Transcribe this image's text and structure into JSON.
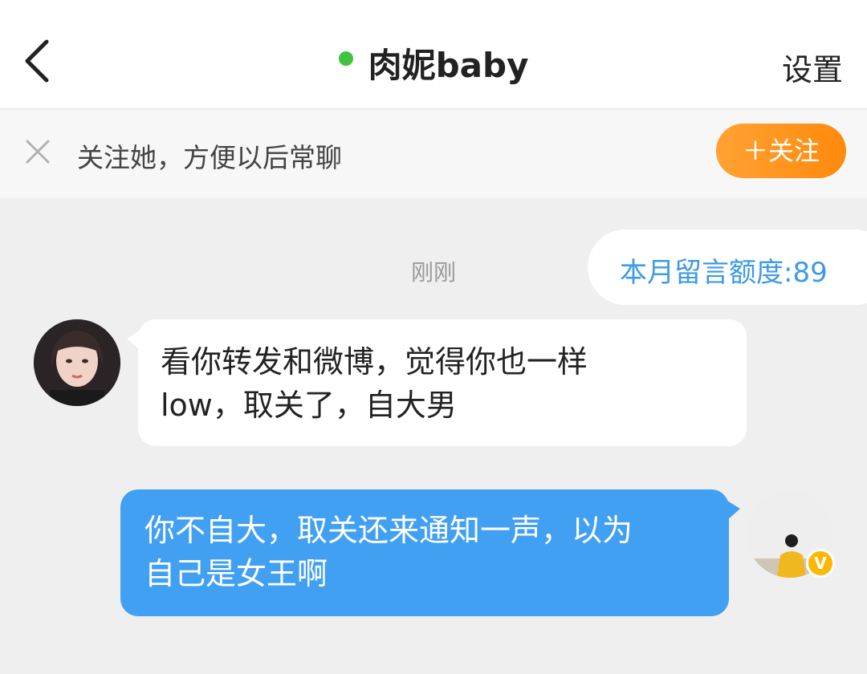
{
  "header": {
    "title": "肉妮baby",
    "settings_label": "设置",
    "online_color": "#41c33f"
  },
  "follow_bar": {
    "text": "关注她，方便以后常聊",
    "button_label": "＋关注"
  },
  "chat": {
    "quota": "本月留言额度:89",
    "timestamp": "刚刚",
    "messages": [
      {
        "sender": "other",
        "lines": [
          "看你转发和微博，觉得你也一样",
          "low，取关了，自大男"
        ]
      },
      {
        "sender": "self",
        "lines": [
          "你不自大，取关还来通知一声，以为",
          "自己是女王啊"
        ],
        "badge": "V"
      }
    ]
  },
  "colors": {
    "accent_orange": "#ff8a0c",
    "self_bubble": "#42a0f2",
    "quota_blue": "#3d9ae8"
  },
  "icons": [
    "back-icon",
    "close-icon",
    "verified-badge-icon"
  ]
}
